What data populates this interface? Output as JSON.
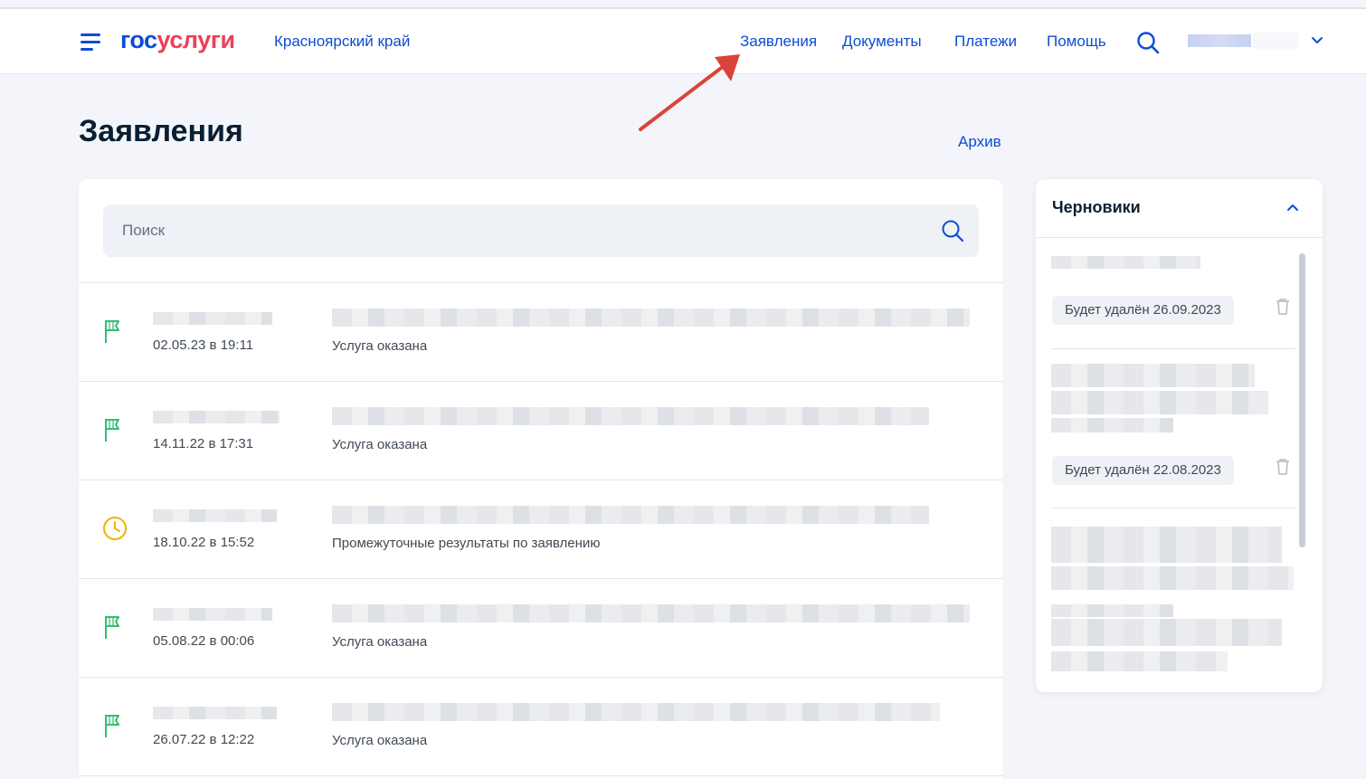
{
  "header": {
    "logo_part1": "гос",
    "logo_part2": "услуги",
    "region": "Красноярский край",
    "nav": [
      "Заявления",
      "Документы",
      "Платежи",
      "Помощь"
    ]
  },
  "page": {
    "title": "Заявления",
    "archive_link": "Архив"
  },
  "search": {
    "placeholder": "Поиск"
  },
  "applications": [
    {
      "date": "02.05.23 в 19:11",
      "status": "Услуга оказана",
      "icon": "flag-icon"
    },
    {
      "date": "14.11.22 в 17:31",
      "status": "Услуга оказана",
      "icon": "flag-icon"
    },
    {
      "date": "18.10.22 в 15:52",
      "status": "Промежуточные результаты по заявлению",
      "icon": "clock-icon"
    },
    {
      "date": "05.08.22 в 00:06",
      "status": "Услуга оказана",
      "icon": "flag-icon"
    },
    {
      "date": "26.07.22 в 12:22",
      "status": "Услуга оказана",
      "icon": "flag-icon"
    }
  ],
  "drafts": {
    "title": "Черновики",
    "items": [
      {
        "badge": "Будет удалён 26.09.2023"
      },
      {
        "badge": "Будет удалён 22.08.2023"
      }
    ]
  },
  "colors": {
    "brand_blue": "#0d4cd3",
    "brand_red": "#ee3f58",
    "flag_green": "#2fbf71",
    "clock_yellow": "#f0b400",
    "annotation_arrow": "#d9443a"
  }
}
